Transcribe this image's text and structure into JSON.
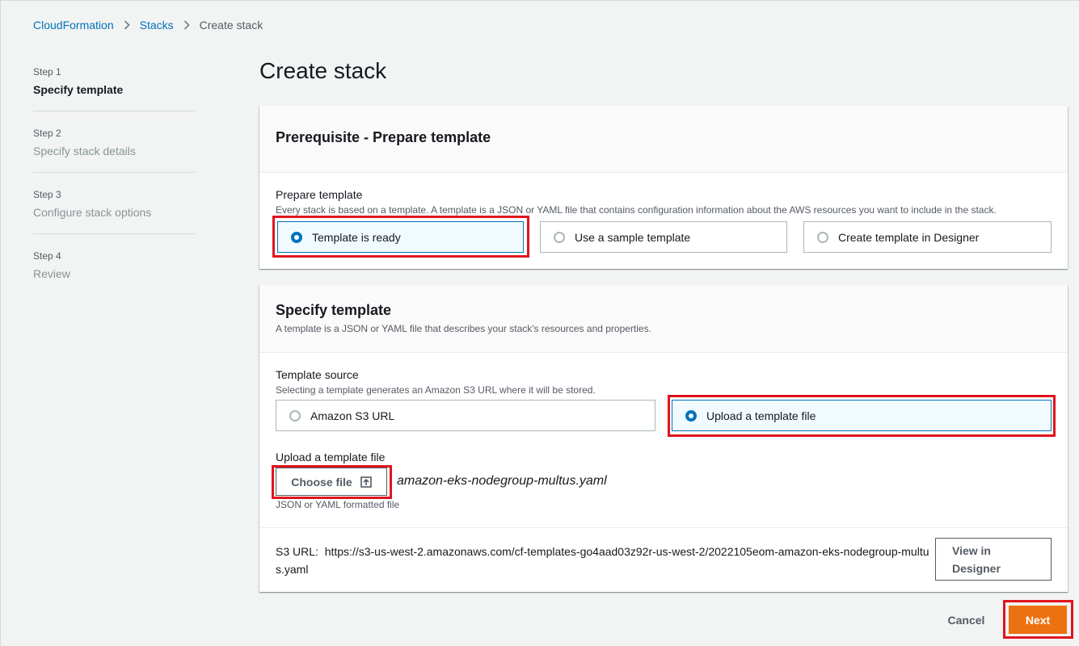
{
  "breadcrumb": {
    "items": [
      {
        "label": "CloudFormation"
      },
      {
        "label": "Stacks"
      },
      {
        "label": "Create stack"
      }
    ]
  },
  "steps": [
    {
      "number": "Step 1",
      "title": "Specify template",
      "active": true
    },
    {
      "number": "Step 2",
      "title": "Specify stack details",
      "active": false
    },
    {
      "number": "Step 3",
      "title": "Configure stack options",
      "active": false
    },
    {
      "number": "Step 4",
      "title": "Review",
      "active": false
    }
  ],
  "page": {
    "title": "Create stack"
  },
  "prerequisite": {
    "heading": "Prerequisite - Prepare template",
    "field_label": "Prepare template",
    "field_desc": "Every stack is based on a template. A template is a JSON or YAML file that contains configuration information about the AWS resources you want to include in the stack.",
    "options": [
      {
        "label": "Template is ready",
        "selected": true
      },
      {
        "label": "Use a sample template",
        "selected": false
      },
      {
        "label": "Create template in Designer",
        "selected": false
      }
    ]
  },
  "specify": {
    "heading": "Specify template",
    "desc": "A template is a JSON or YAML file that describes your stack's resources and properties.",
    "source_label": "Template source",
    "source_desc": "Selecting a template generates an Amazon S3 URL where it will be stored.",
    "source_options": [
      {
        "label": "Amazon S3 URL",
        "selected": false
      },
      {
        "label": "Upload a template file",
        "selected": true
      }
    ],
    "upload_label": "Upload a template file",
    "choose_file_label": "Choose file",
    "file_name": "amazon-eks-nodegroup-multus.yaml",
    "upload_hint": "JSON or YAML formatted file",
    "s3_url_label": "S3 URL:",
    "s3_url": "https://s3-us-west-2.amazonaws.com/cf-templates-go4aad03z92r-us-west-2/2022105eom-amazon-eks-nodegroup-multus.yaml",
    "view_designer_line1": "View in",
    "view_designer_line2": "Designer"
  },
  "footer": {
    "cancel_label": "Cancel",
    "next_label": "Next"
  },
  "colors": {
    "accent": "#0073bb",
    "primary_button": "#ec7211",
    "highlight_box": "#e0141e"
  }
}
